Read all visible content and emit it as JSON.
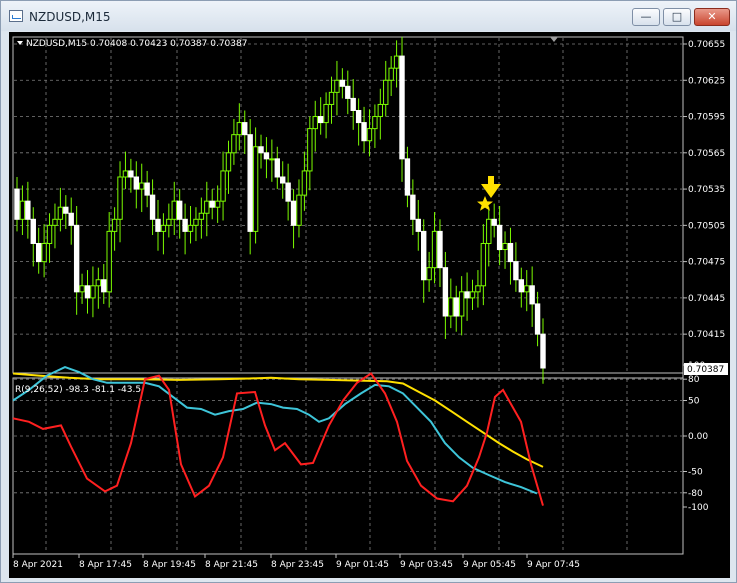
{
  "window": {
    "title": "NZDUSD,M15",
    "minimize_label": "—",
    "maximize_label": "□",
    "close_label": "✕"
  },
  "main_chart": {
    "header_text": "NZDUSD,M15  0.70408 0.70423 0.70387 0.70387",
    "price_axis": [
      "0.70655",
      "0.70625",
      "0.70595",
      "0.70565",
      "0.70535",
      "0.70505",
      "0.70475",
      "0.70445",
      "0.70415"
    ],
    "current_price": "0.70387",
    "up_color": "#7CFC00",
    "down_color": "#FFFFFF"
  },
  "indicator": {
    "header_text": "R(9,26,52) -98.3 -81.1 -43.5",
    "levels": [
      "100",
      "80",
      "50",
      "0.00",
      "-50",
      "-80",
      "-100"
    ],
    "fast_color": "#FF2020",
    "mid_color": "#3EC5D9",
    "slow_color": "#FFE000"
  },
  "time_axis": [
    "8 Apr 2021",
    "8 Apr 17:45",
    "8 Apr 19:45",
    "8 Apr 21:45",
    "8 Apr 23:45",
    "9 Apr 01:45",
    "9 Apr 03:45",
    "9 Apr 05:45",
    "9 Apr 07:45"
  ],
  "icons": {
    "arrow": "down-arrow-icon",
    "star": "star-icon"
  }
}
